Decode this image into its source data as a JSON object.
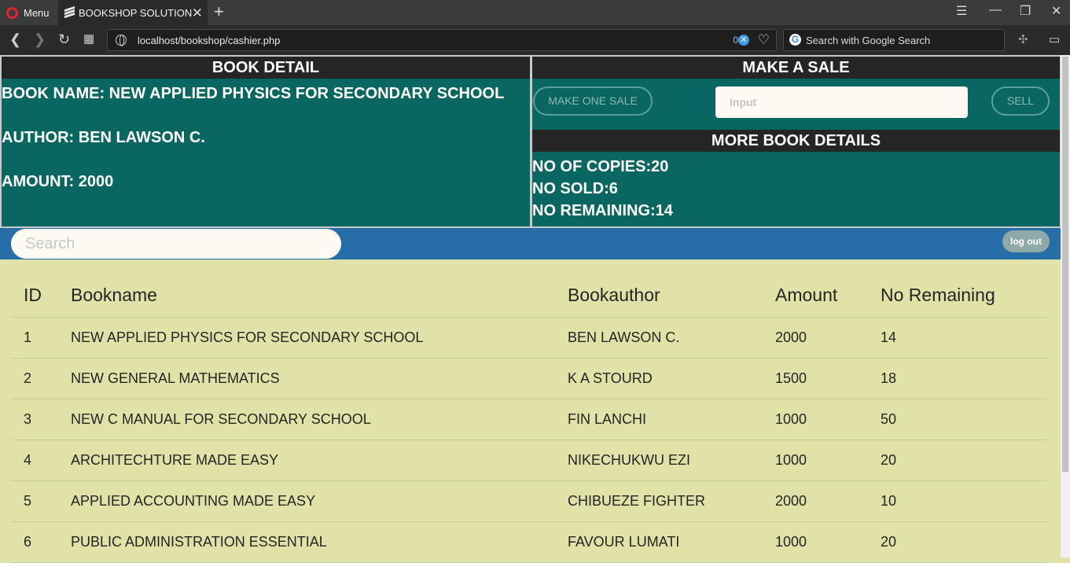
{
  "browser": {
    "menu_label": "Menu",
    "tab_title": "BOOKSHOP SOLUTION",
    "url": "localhost/bookshop/cashier.php",
    "blocker_count": "0",
    "search_placeholder": "Search with Google Search"
  },
  "book_detail": {
    "heading": "BOOK DETAIL",
    "name": "BOOK NAME: NEW APPLIED PHYSICS FOR SECONDARY SCHOOL",
    "author": "AUTHOR: BEN LAWSON C.",
    "amount": "AMOUNT: 2000"
  },
  "make_sale": {
    "heading": "MAKE A SALE",
    "one_sale_label": "MAKE ONE SALE",
    "input_placeholder": "Input",
    "sell_label": "SELL"
  },
  "more_details": {
    "heading": "MORE BOOK DETAILS",
    "copies": "NO OF COPIES:20",
    "sold": "NO SOLD:6",
    "remaining": "NO REMAINING:14"
  },
  "search": {
    "placeholder": "Search"
  },
  "logout_label": "log out",
  "table": {
    "headers": [
      "ID",
      "Bookname",
      "Bookauthor",
      "Amount",
      "No Remaining"
    ],
    "rows": [
      [
        "1",
        "NEW APPLIED PHYSICS FOR SECONDARY SCHOOL",
        "BEN LAWSON C.",
        "2000",
        "14"
      ],
      [
        "2",
        "NEW GENERAL MATHEMATICS",
        "K A STOURD",
        "1500",
        "18"
      ],
      [
        "3",
        "NEW C MANUAL FOR SECONDARY SCHOOL",
        "FIN LANCHI",
        "1000",
        "50"
      ],
      [
        "4",
        "ARCHITECHTURE MADE EASY",
        "NIKECHUKWU EZI",
        "1000",
        "20"
      ],
      [
        "5",
        "APPLIED ACCOUNTING MADE EASY",
        "CHIBUEZE FIGHTER",
        "2000",
        "10"
      ],
      [
        "6",
        "PUBLIC ADMINISTRATION ESSENTIAL",
        "FAVOUR LUMATI",
        "1000",
        "20"
      ]
    ]
  },
  "colors": {
    "panel_teal": "#0a6661",
    "panel_header": "#252525",
    "search_bar_blue": "#256ea8",
    "page_background": "#e1e2a8",
    "logout_button": "#8fa9a9"
  },
  "icons": [
    "opera-logo-icon",
    "tab-stack-icon",
    "close-tab-icon",
    "new-tab-icon",
    "back-icon",
    "forward-icon",
    "reload-icon",
    "speed-dial-icon",
    "globe-icon",
    "blocker-icon",
    "heart-icon",
    "google-icon",
    "extension-icon",
    "battery-icon"
  ]
}
